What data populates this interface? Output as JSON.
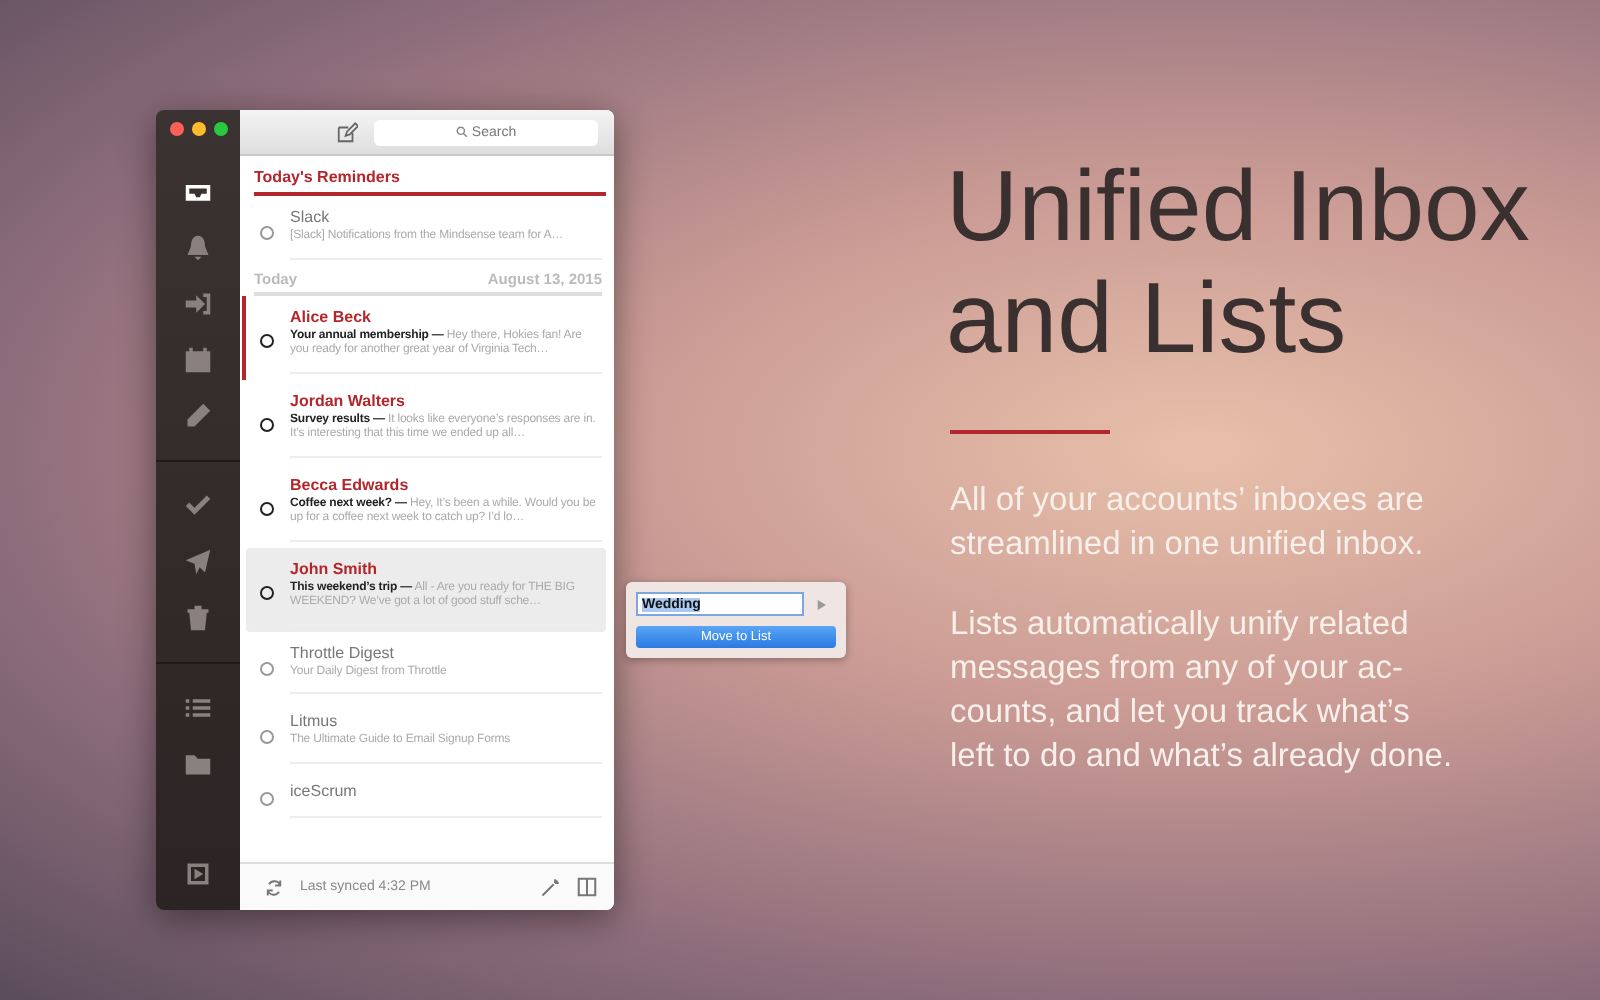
{
  "search": {
    "placeholder": "Search"
  },
  "reminders": {
    "title": "Today's Reminders",
    "items": [
      {
        "sender": "Slack",
        "preview": "[Slack] Notifications from the Mindsense team for A…"
      }
    ]
  },
  "today": {
    "label": "Today",
    "date": "August 13, 2015",
    "messages": [
      {
        "sender": "Alice Beck",
        "preview": "**Your annual membership —** Hey there, Hokies fan! Are you ready for another great year of Virginia Tech…",
        "unread": true,
        "highlighted": true,
        "selected": false
      },
      {
        "sender": "Jordan Walters",
        "preview": "**Survey results —** It looks like everyone’s responses are in. It’s interesting that this time we ended up all…",
        "unread": true,
        "highlighted": false,
        "selected": false
      },
      {
        "sender": "Becca Edwards",
        "preview": "**Coffee next week? —** Hey, It’s been a while. Would you be up for a coffee next week to catch up? I’d lo…",
        "unread": true,
        "highlighted": false,
        "selected": false
      },
      {
        "sender": "John Smith",
        "preview": "**This weekend’s trip —** All - Are you ready for THE BIG WEEKEND? We’ve got a lot of good stuff sche…",
        "unread": true,
        "highlighted": false,
        "selected": true
      },
      {
        "sender": "Throttle Digest",
        "preview": "Your Daily Digest from Throttle",
        "unread": false,
        "highlighted": false,
        "selected": false
      },
      {
        "sender": "Litmus",
        "preview": "The Ultimate Guide to Email Signup Forms",
        "unread": false,
        "highlighted": false,
        "selected": false
      },
      {
        "sender": "iceScrum",
        "unread": false,
        "highlighted": false,
        "selected": false
      }
    ]
  },
  "footer": {
    "status": "Last synced 4:32 PM"
  },
  "popover": {
    "value": "Wedding",
    "button": "Move to List"
  },
  "promo": {
    "title": "Unified Inbox\nand Lists",
    "paragraphs": [
      "All of your accounts’ inboxes are\nstreamlined in one unified inbox.",
      "Lists automatically unify related\nmessages from any of your ac-\ncounts, and let you track what’s\nleft to do and what’s already done."
    ]
  }
}
